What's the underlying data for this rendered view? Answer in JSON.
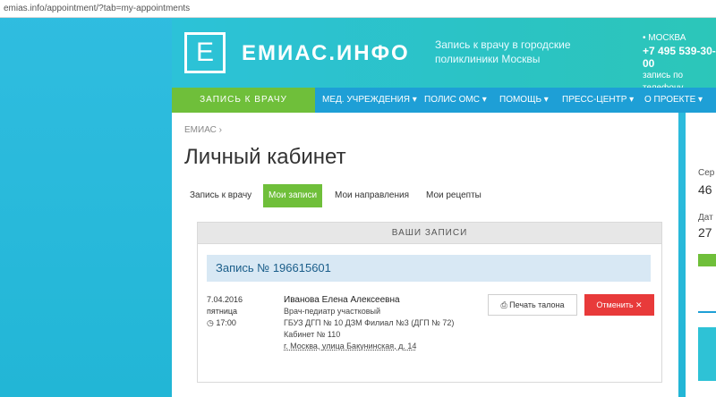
{
  "browser": {
    "url": "emias.info/appointment/?tab=my-appointments"
  },
  "header": {
    "logo_letter": "Е",
    "logo_text": "ЕМИАС.ИНФО",
    "tagline": "Запись к врачу в городские поликлиники Москвы",
    "city": "• МОСКВА",
    "phone": "+7 495 539-30-00",
    "phone_note": "запись по телефону"
  },
  "nav": {
    "primary": "ЗАПИСЬ К ВРАЧУ",
    "items": [
      "МЕД. УЧРЕЖДЕНИЯ ▾",
      "ПОЛИС ОМС ▾",
      "ПОМОЩЬ ▾",
      "ПРЕСС-ЦЕНТР ▾",
      "О ПРОЕКТЕ ▾"
    ]
  },
  "main": {
    "breadcrumb": "ЕМИАС  ›",
    "title": "Личный кабинет",
    "tabs": [
      "Запись к врачу",
      "Мои записи",
      "Мои направления",
      "Мои рецепты"
    ],
    "panel_header": "ВАШИ ЗАПИСИ",
    "record": {
      "label": "Запись № 196615601",
      "date": "7.04.2016",
      "weekday": "пятница",
      "time": "◷ 17:00",
      "doctor": "Иванова Елена Алексеевна",
      "specialty": "Врач-педиатр участковый",
      "clinic": "ГБУЗ ДГП № 10 ДЗМ Филиал №3 (ДГП № 72)",
      "room": "Кабинет № 110",
      "address": "г. Москва, улица Бакунинская, д. 14",
      "print_label": "⎙ Печать талона",
      "cancel_label": "Отменить ✕"
    }
  },
  "sidebar": {
    "label1": "Сер",
    "value1": "46",
    "label2": "Дат",
    "value2": "27"
  },
  "colors": {
    "accent_green": "#6fbf3a",
    "nav_blue": "#1e9fd6",
    "cancel_red": "#e83a3a",
    "record_bar": "#d8e8f4"
  }
}
